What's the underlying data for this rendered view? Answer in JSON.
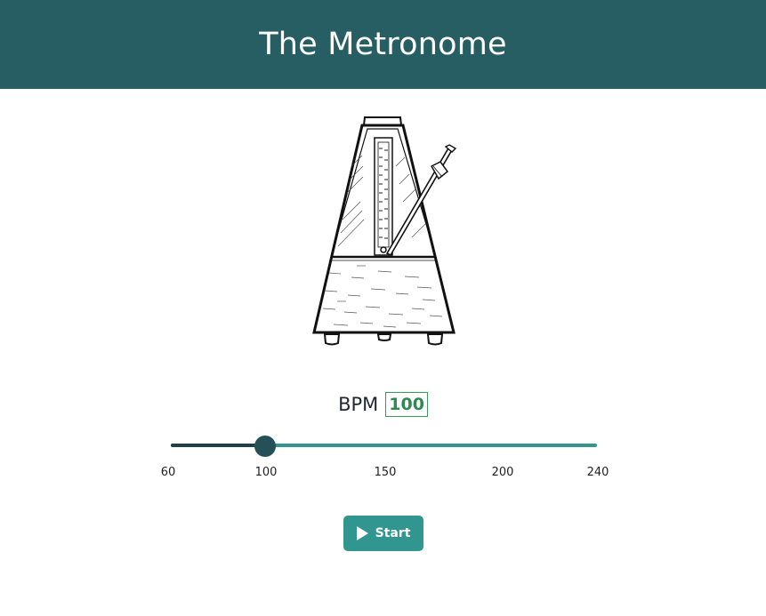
{
  "header": {
    "title": "The Metronome"
  },
  "tempo": {
    "label": "BPM",
    "value": "100",
    "min": 60,
    "max": 240,
    "current": 100,
    "ticks": [
      "60",
      "100",
      "150",
      "200",
      "240"
    ]
  },
  "controls": {
    "start_label": "Start",
    "start_icon": "play-icon"
  },
  "colors": {
    "header": "#265e63",
    "accent": "#31968f",
    "slider_fill": "#203e4c",
    "slider_thumb": "#265058",
    "bpm_value": "#2f8a4f"
  }
}
